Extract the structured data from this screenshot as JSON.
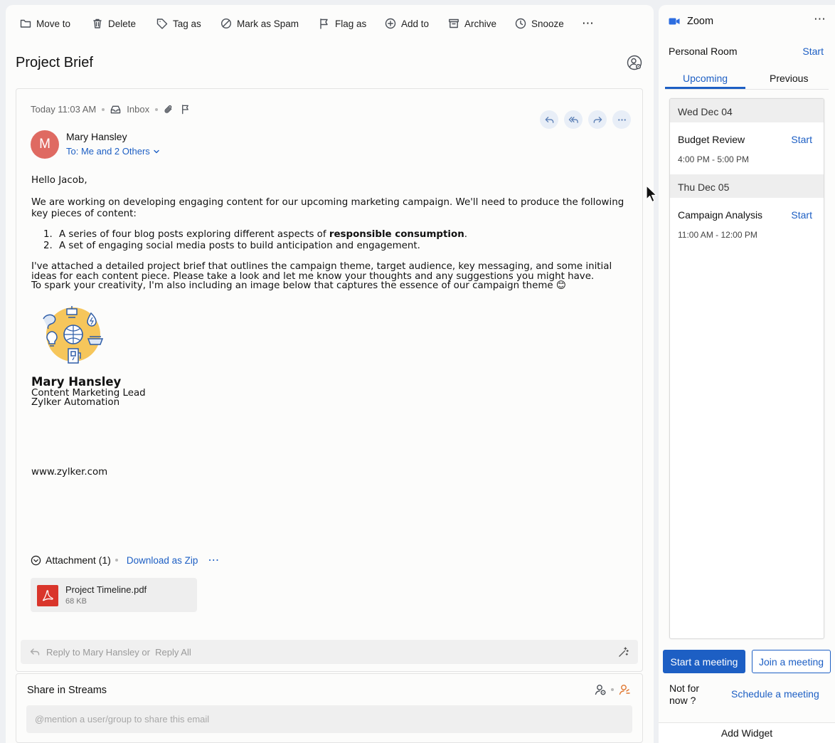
{
  "toolbar": {
    "items": [
      {
        "label": "Move to",
        "icon": "folder-icon"
      },
      {
        "label": "Delete",
        "icon": "trash-icon"
      },
      {
        "label": "Tag as",
        "icon": "tag-icon"
      },
      {
        "label": "Mark as Spam",
        "icon": "spam-icon"
      },
      {
        "label": "Flag as",
        "icon": "flag-icon"
      },
      {
        "label": "Add to",
        "icon": "plus-circle-icon"
      },
      {
        "label": "Archive",
        "icon": "archive-icon"
      },
      {
        "label": "Snooze",
        "icon": "clock-icon"
      }
    ],
    "more": "⋯"
  },
  "email": {
    "subject": "Project Brief",
    "timestamp": "Today 11:03 AM",
    "folder": "Inbox",
    "sender_initial": "M",
    "sender": "Mary Hansley",
    "recipients": "To: Me and 2 Others",
    "greeting": "Hello Jacob,",
    "para1": "We are working on developing engaging content for our upcoming marketing campaign. We'll need to produce the following key pieces of content:",
    "list": [
      {
        "num": "1.",
        "before": "A series of four blog posts exploring different aspects of ",
        "bold": "responsible consumption",
        "after": "."
      },
      {
        "num": "2.",
        "before": "A set of engaging social media posts to build anticipation and engagement.",
        "bold": "",
        "after": ""
      }
    ],
    "para2_line1": "I've attached a detailed project brief that outlines the campaign theme, target audience, key messaging, and some initial",
    "para2_line2": "ideas for each content piece. Please take a look and let me know your thoughts and any suggestions you might have.",
    "para2_line3": "To spark your creativity, I'm also including an image below that captures the essence of our campaign theme 😊",
    "signature": {
      "name": "Mary Hansley",
      "role": "Content Marketing Lead",
      "company": "Zylker Automation"
    },
    "website": "www.zylker.com",
    "attachments_label": "Attachment (1)",
    "download_zip": "Download as Zip",
    "attachment_more": "⋯",
    "file_name": "Project Timeline.pdf",
    "file_size": "68 KB",
    "reply_placeholder": "Reply to Mary Hansley or  Reply All"
  },
  "streams": {
    "title": "Share in Streams",
    "placeholder": "@mention a user/group to share this email"
  },
  "zoom": {
    "title": "Zoom",
    "more": "⋯",
    "personal_room": "Personal Room",
    "personal_start": "Start",
    "tabs": [
      "Upcoming",
      "Previous"
    ],
    "days": [
      {
        "date": "Wed Dec 04",
        "meetings": [
          {
            "title": "Budget Review",
            "time": "4:00 PM - 5:00 PM",
            "action": "Start"
          }
        ]
      },
      {
        "date": "Thu Dec 05",
        "meetings": [
          {
            "title": "Campaign Analysis",
            "time": "11:00 AM - 12:00 PM",
            "action": "Start"
          }
        ]
      }
    ],
    "start_meeting": "Start a meeting",
    "join_meeting": "Join a meeting",
    "not_now": "Not for now ?",
    "schedule": "Schedule a meeting",
    "add_widget": "Add Widget"
  },
  "colors": {
    "accent": "#1d5fc4",
    "avatar": "#df6a62",
    "pdf": "#d9352b"
  }
}
